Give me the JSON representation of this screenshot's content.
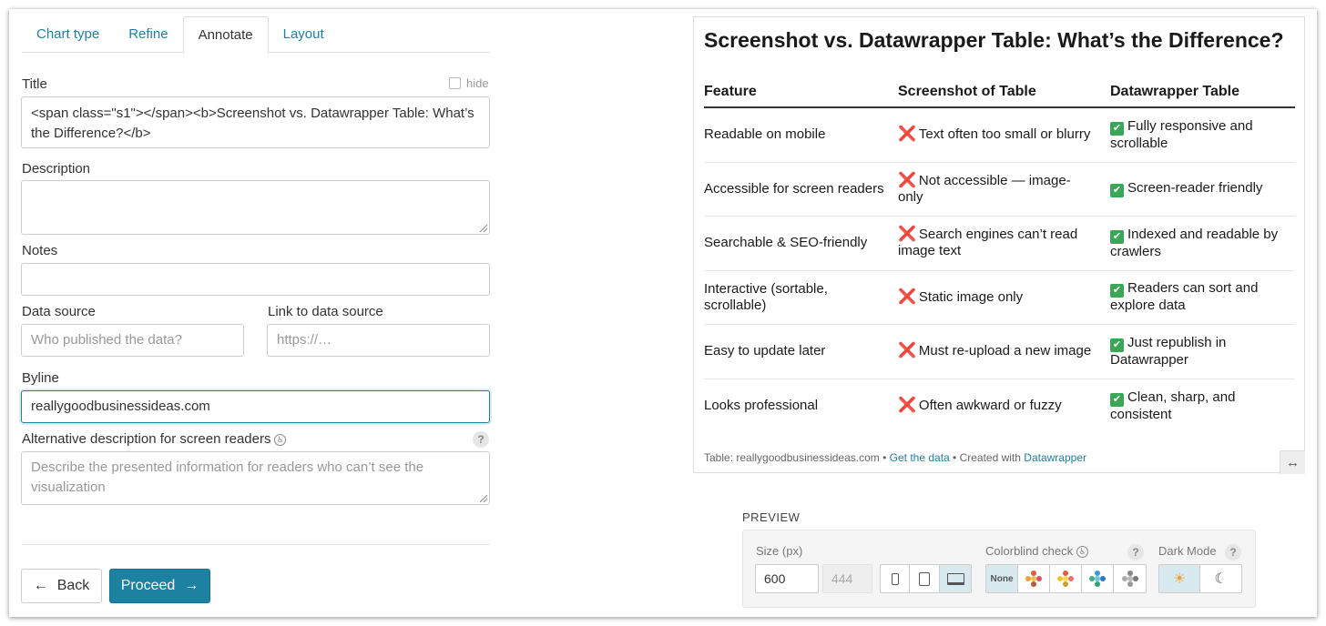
{
  "tabs": [
    "Chart type",
    "Refine",
    "Annotate",
    "Layout"
  ],
  "form": {
    "title_label": "Title",
    "hide_label": "hide",
    "title_value": "<span class=\"s1\"></span><b>Screenshot vs. Datawrapper Table: What’s the Difference?</b>",
    "description_label": "Description",
    "notes_label": "Notes",
    "data_source_label": "Data source",
    "data_source_placeholder": "Who published the data?",
    "link_label": "Link to data source",
    "link_placeholder": "https://…",
    "byline_label": "Byline",
    "byline_value": "reallygoodbusinessideas.com",
    "alt_label": "Alternative description for screen readers",
    "alt_placeholder": "Describe the presented information for readers who can’t see the visualization",
    "help_glyph": "?"
  },
  "buttons": {
    "back": "Back",
    "back_arrow": "←",
    "proceed": "Proceed",
    "proceed_arrow": "→"
  },
  "table": {
    "title": "Screenshot vs. Datawrapper Table: What’s the Difference?",
    "headers": [
      "Feature",
      "Screenshot of Table",
      "Datawrapper Table"
    ],
    "x_mark": "❌",
    "check_mark": "✔",
    "rows": [
      [
        "Readable on mobile",
        "Text often too small or blurry",
        "Fully responsive and scrollable"
      ],
      [
        "Accessible for screen readers",
        "Not accessible — image-only",
        "Screen-reader friendly"
      ],
      [
        "Searchable & SEO-friendly",
        "Search engines can’t read image text",
        "Indexed and readable by crawlers"
      ],
      [
        "Interactive (sortable, scrollable)",
        "Static image only",
        "Readers can sort and explore data"
      ],
      [
        "Easy to update later",
        "Must re-upload a new image",
        "Just republish in Datawrapper"
      ],
      [
        "Looks professional",
        "Often awkward or fuzzy",
        "Clean, sharp, and consistent"
      ]
    ],
    "footer_prefix": "Table: reallygoodbusinessideas.com • ",
    "footer_get_data": "Get the data",
    "footer_mid": " • Created with ",
    "footer_dw": "Datawrapper",
    "resize_glyph": "↔"
  },
  "preview": {
    "heading": "PREVIEW",
    "size_label": "Size (px)",
    "width": "600",
    "height": "444",
    "colorblind_label": "Colorblind check",
    "colorblind_none": "None",
    "dark_mode_label": "Dark Mode",
    "sun_glyph": "☀",
    "moon_glyph": "☾"
  }
}
